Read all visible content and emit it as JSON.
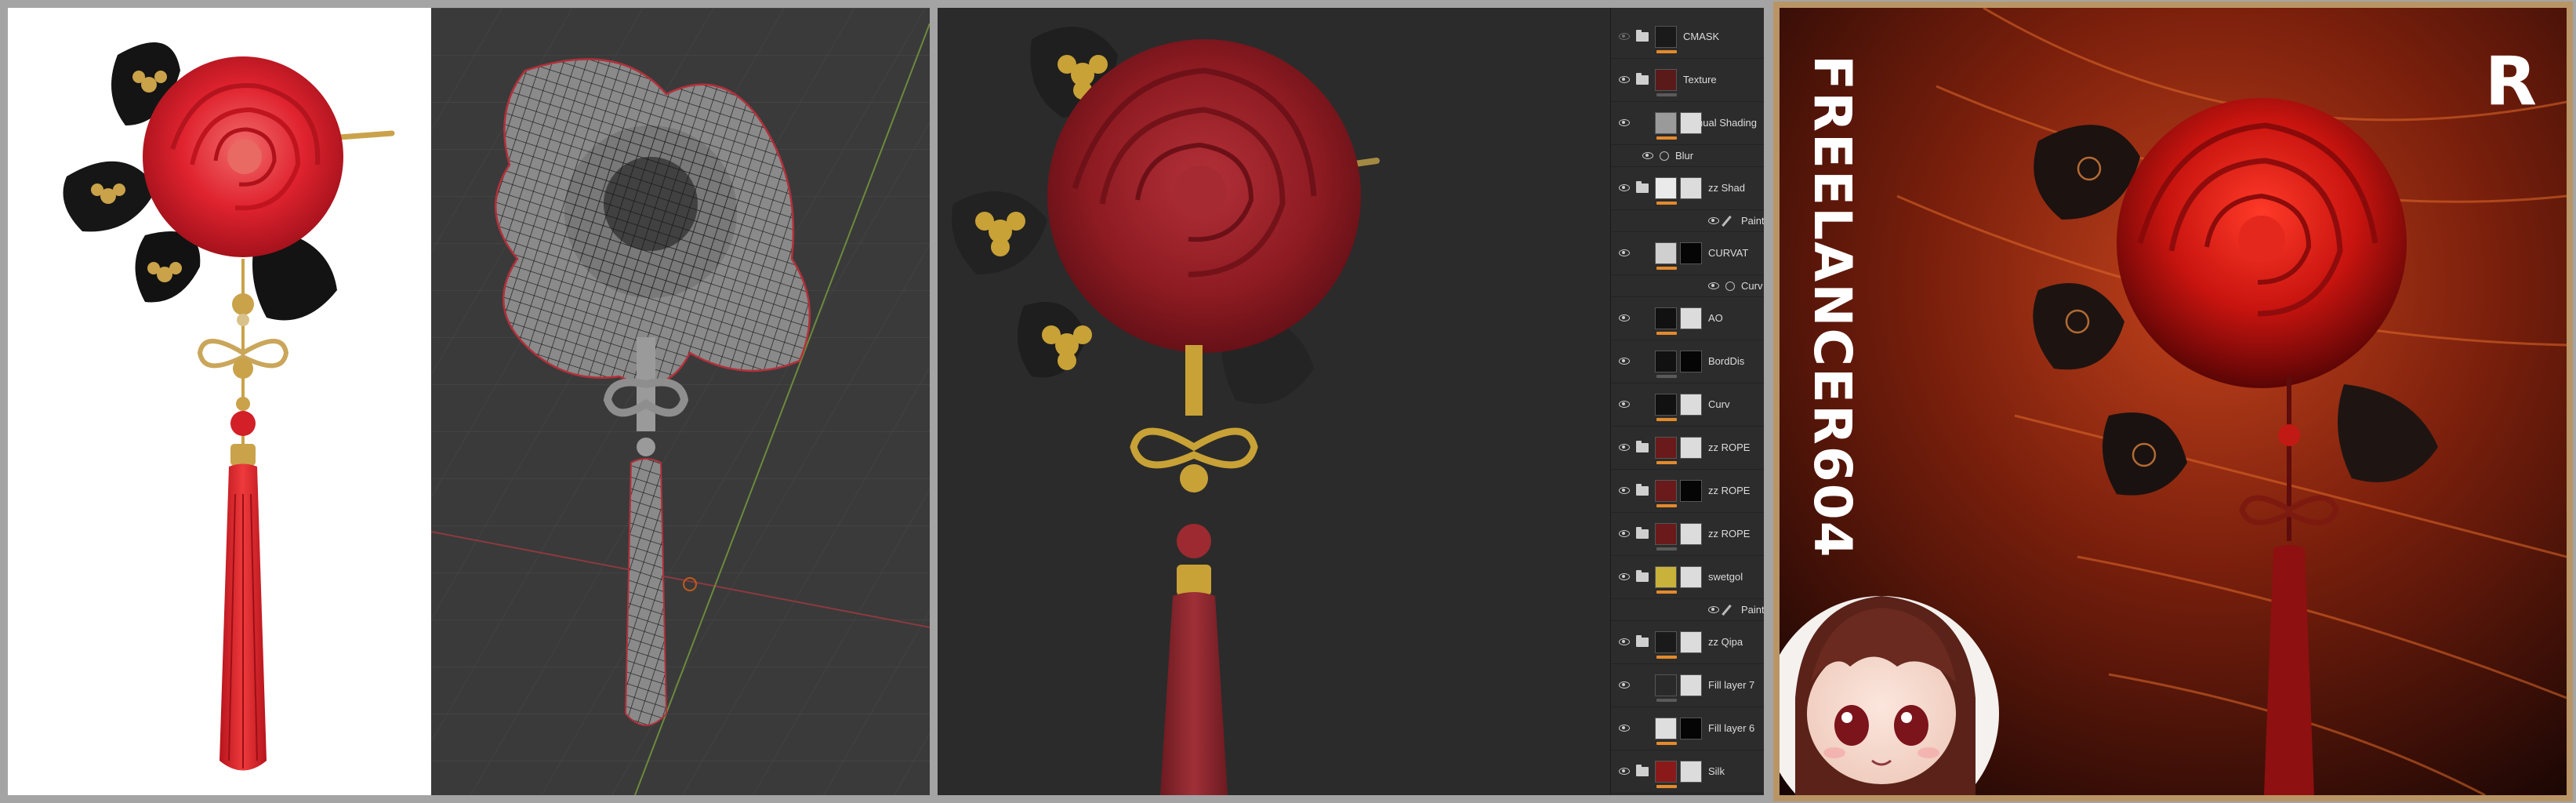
{
  "render": {
    "watermark": "FREELANCER604",
    "logo": "R"
  },
  "layers_panel": {
    "layers": [
      {
        "name": "CMASK",
        "visible": false,
        "type": "folder"
      },
      {
        "name": "Texture",
        "visible": true,
        "type": "folder"
      },
      {
        "name": "Manual Shading",
        "visible": true,
        "type": "layer"
      },
      {
        "name": "Blur",
        "visible": true,
        "type": "effect"
      },
      {
        "name": "zz Shad",
        "visible": true,
        "type": "folder"
      },
      {
        "name": "Paint",
        "visible": true,
        "type": "effect"
      },
      {
        "name": "CURVAT",
        "visible": true,
        "type": "layer"
      },
      {
        "name": "Curv",
        "visible": true,
        "type": "effect"
      },
      {
        "name": "AO",
        "visible": true,
        "type": "layer"
      },
      {
        "name": "BordDis",
        "visible": true,
        "type": "layer"
      },
      {
        "name": "Curv",
        "visible": true,
        "type": "layer"
      },
      {
        "name": "zz ROPE",
        "visible": true,
        "type": "folder"
      },
      {
        "name": "zz ROPE",
        "visible": true,
        "type": "folder"
      },
      {
        "name": "zz ROPE",
        "visible": true,
        "type": "folder"
      },
      {
        "name": "swetgol",
        "visible": true,
        "type": "folder"
      },
      {
        "name": "Paint",
        "visible": true,
        "type": "effect"
      },
      {
        "name": "zz Qipa",
        "visible": true,
        "type": "folder"
      },
      {
        "name": "Fill layer 7",
        "visible": true,
        "type": "layer"
      },
      {
        "name": "Fill layer 6",
        "visible": true,
        "type": "layer"
      },
      {
        "name": "Silk",
        "visible": true,
        "type": "folder"
      }
    ]
  },
  "colors": {
    "rose_red": "#d61f2a",
    "rose_dark": "#a3121b",
    "gold": "#c9a24a",
    "viewport_bg": "#3a3a3a",
    "highlight_orange": "#e38a2c"
  }
}
